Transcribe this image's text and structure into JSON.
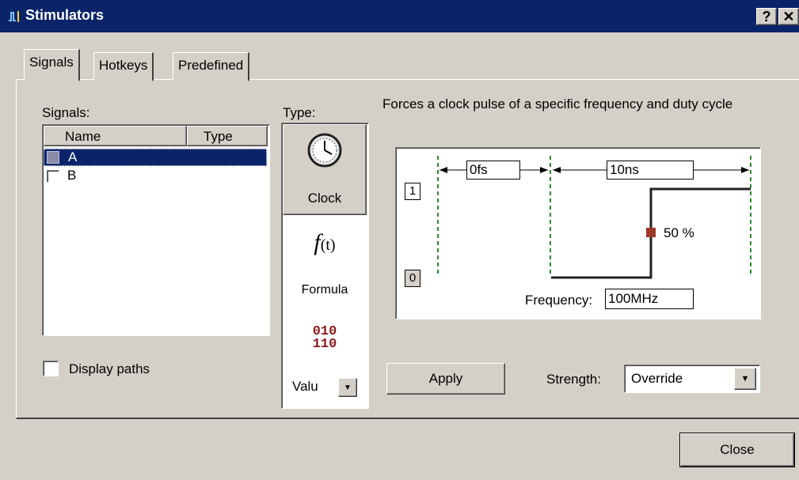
{
  "window": {
    "title": "Stimulators",
    "help_glyph": "?",
    "close_glyph": "✕"
  },
  "tabs": [
    {
      "label": "Signals"
    },
    {
      "label": "Hotkeys"
    },
    {
      "label": "Predefined"
    }
  ],
  "signals": {
    "label": "Signals:",
    "columns": [
      "Name",
      "Type"
    ],
    "rows": [
      {
        "name": "A"
      },
      {
        "name": "B"
      }
    ],
    "display_paths_label": "Display paths"
  },
  "type": {
    "label": "Type:",
    "items": [
      {
        "label": "Clock",
        "icon": "clock-icon"
      },
      {
        "label": "Formula",
        "icon": "formula-icon",
        "glyph": "f",
        "glyph2": "(t)"
      },
      {
        "label": "Valu",
        "icon": "value-icon",
        "glyph_top": "010",
        "glyph_bottom": "110"
      }
    ]
  },
  "description": "Forces a clock pulse of a specific frequency and duty cycle",
  "waveform": {
    "level_high": "1",
    "level_low": "0",
    "offset": "0fs",
    "period": "10ns",
    "duty": "50 %",
    "frequency_label": "Frequency:",
    "frequency": "100MHz"
  },
  "apply_label": "Apply",
  "strength": {
    "label": "Strength:",
    "value": "Override"
  },
  "close_label": "Close",
  "colors": {
    "titlebar": "#0a246a",
    "selection": "#0a246a",
    "face": "#d4d0c8",
    "duty_marker": "#a0382a"
  }
}
